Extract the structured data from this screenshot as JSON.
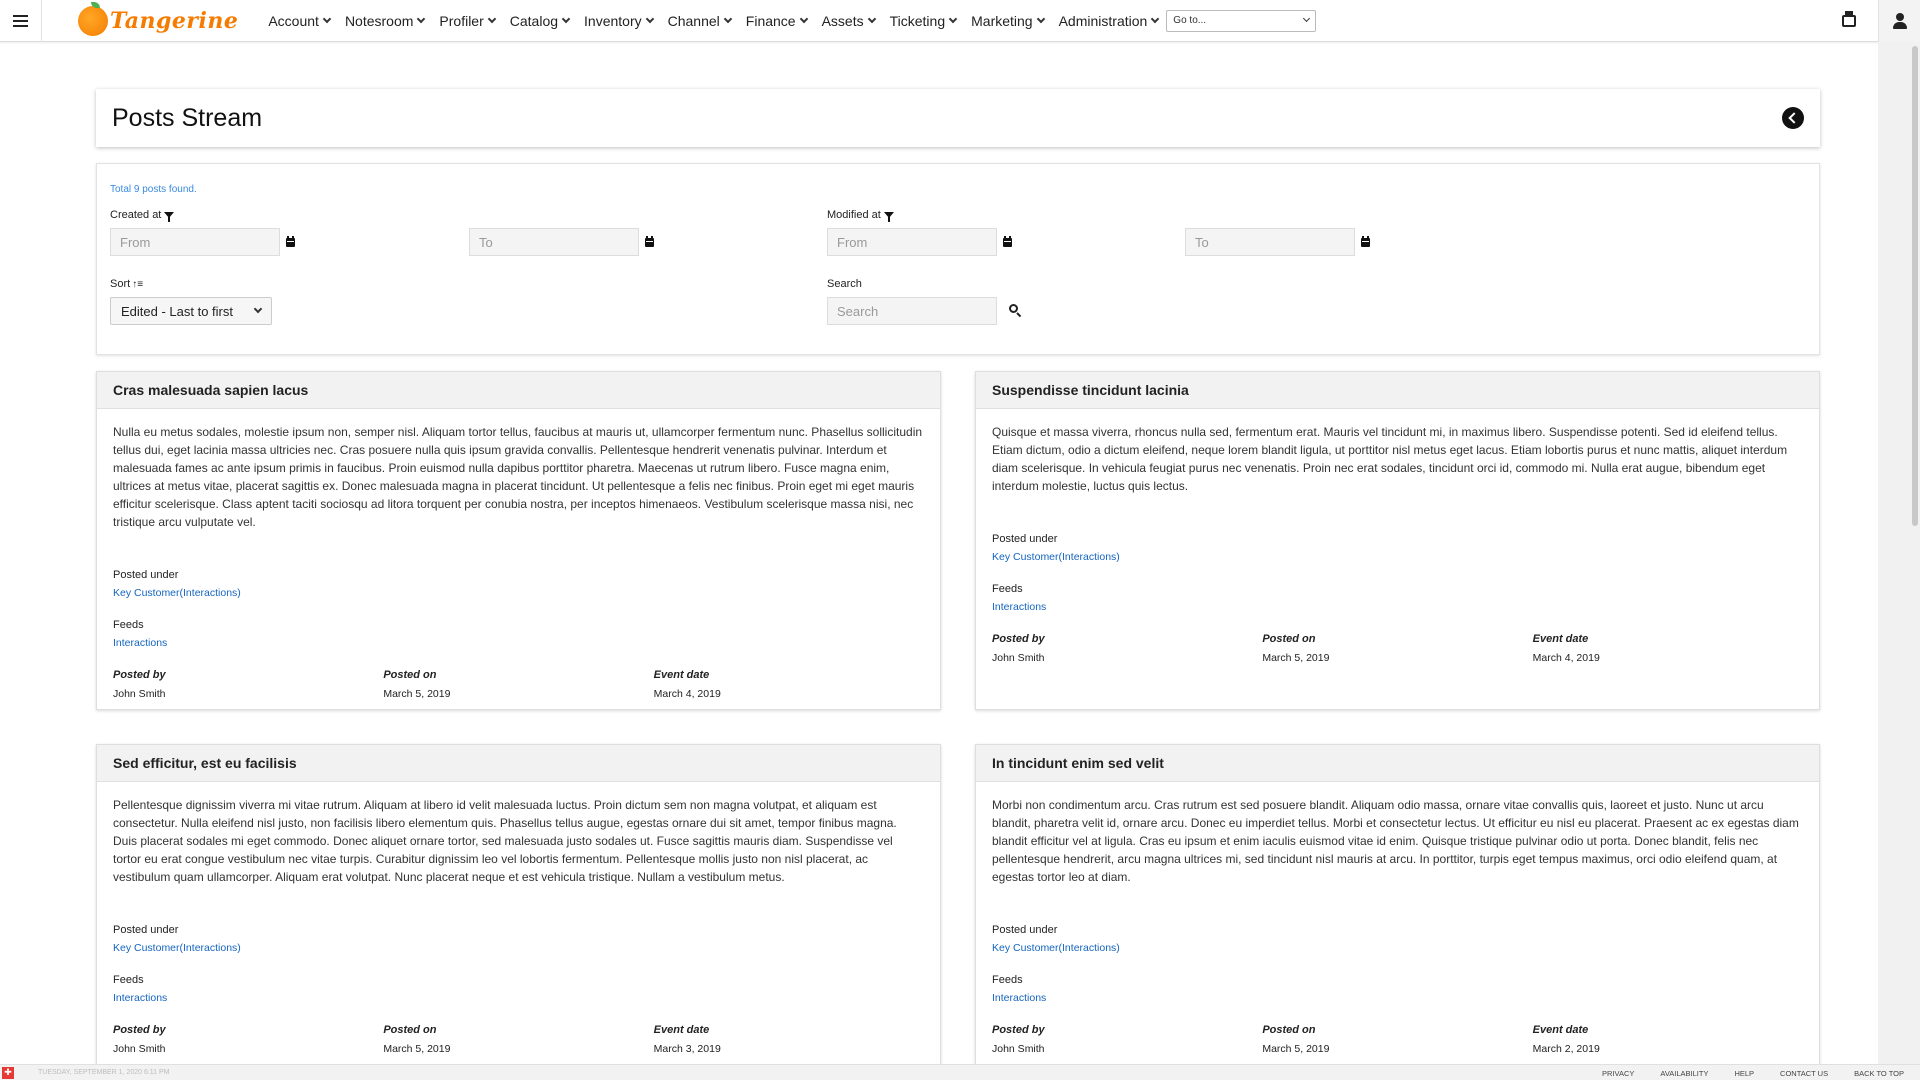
{
  "nav": {
    "brand": "Tangerine",
    "items": [
      "Account",
      "Notesroom",
      "Profiler",
      "Catalog",
      "Inventory",
      "Channel",
      "Finance",
      "Assets",
      "Ticketing",
      "Marketing",
      "Administration"
    ],
    "goto_label": "Go to..."
  },
  "header": {
    "title": "Posts Stream"
  },
  "filters": {
    "total": "Total 9 posts found.",
    "created_label": "Created at",
    "modified_label": "Modified at",
    "from_placeholder": "From",
    "to_placeholder": "To",
    "sort_label": "Sort",
    "sort_value": "Edited - Last to first",
    "search_label": "Search",
    "search_placeholder": "Search"
  },
  "labels": {
    "posted_under": "Posted under",
    "feeds": "Feeds",
    "posted_by": "Posted by",
    "posted_on": "Posted on",
    "event_date": "Event date"
  },
  "posts": [
    {
      "title": "Cras malesuada sapien lacus",
      "body": "Nulla eu metus sodales, molestie ipsum non, semper nisl. Aliquam tortor tellus, faucibus at mauris ut, ullamcorper fermentum nunc. Phasellus sollicitudin tellus dui, eget lacinia massa ultricies nec. Cras posuere nulla quis ipsum gravida convallis. Pellentesque hendrerit venenatis pulvinar. Interdum et malesuada fames ac ante ipsum primis in faucibus. Proin euismod nulla dapibus porttitor pharetra. Maecenas ut rutrum libero. Fusce magna enim, ultrices at metus vitae, placerat sagittis ex. Donec malesuada magna in placerat tincidunt. Ut pellentesque a felis nec finibus. Proin eget mi eget mauris efficitur scelerisque. Class aptent taciti sociosqu ad litora torquent per conubia nostra, per inceptos himenaeos. Vestibulum scelerisque massa nisi, nec tristique arcu vulputate vel.",
      "posted_under": "Key Customer(Interactions)",
      "feeds": "Interactions",
      "posted_by": "John Smith",
      "posted_on": "March 5, 2019",
      "event_date": "March 4, 2019"
    },
    {
      "title": "Suspendisse tincidunt lacinia",
      "body": "Quisque et massa viverra, rhoncus nulla sed, fermentum erat. Mauris vel tincidunt mi, in maximus libero. Suspendisse potenti. Sed id eleifend tellus. Etiam dictum, odio a dictum eleifend, neque lorem blandit ligula, ut porttitor nisl metus eget lacus. Etiam lobortis purus et nunc mattis, aliquet interdum diam scelerisque. In vehicula feugiat purus nec venenatis. Proin nec erat sodales, tincidunt orci id, commodo mi. Nulla erat augue, bibendum eget interdum molestie, luctus quis lectus.",
      "posted_under": "Key Customer(Interactions)",
      "feeds": "Interactions",
      "posted_by": "John Smith",
      "posted_on": "March 5, 2019",
      "event_date": "March 4, 2019"
    },
    {
      "title": "Sed efficitur, est eu facilisis",
      "body": "Pellentesque dignissim viverra mi vitae rutrum. Aliquam at libero id velit malesuada luctus. Proin dictum sem non magna volutpat, et aliquam est consectetur. Nulla eleifend nisl justo, non facilisis libero elementum quis. Phasellus tellus augue, egestas ornare dui sit amet, tempor finibus magna. Duis placerat sodales mi eget commodo. Donec aliquet ornare tortor, sed malesuada justo sodales ut. Fusce sagittis mauris diam. Suspendisse vel tortor eu erat congue vestibulum nec vitae turpis. Curabitur dignissim leo vel lobortis fermentum. Pellentesque mollis justo non nisl placerat, ac vestibulum quam ullamcorper. Aliquam erat volutpat. Nunc placerat neque et est vehicula tristique. Nullam a vestibulum metus.",
      "posted_under": "Key Customer(Interactions)",
      "feeds": "Interactions",
      "posted_by": "John Smith",
      "posted_on": "March 5, 2019",
      "event_date": "March 3, 2019"
    },
    {
      "title": "In tincidunt enim sed velit",
      "body": "Morbi non condimentum arcu. Cras rutrum est sed posuere blandit. Aliquam odio massa, ornare vitae convallis quis, laoreet et justo. Nunc ut arcu blandit, pharetra velit id, ornare arcu. Donec eu imperdiet tellus. Morbi et consectetur lectus. Ut efficitur eu nisl eu placerat. Praesent ac ex egestas diam blandit efficitur vel at ligula. Cras eu ipsum et enim iaculis euismod vitae id enim. Quisque tristique pulvinar odio ut porta. Donec blandit, felis nec pellentesque hendrerit, arcu magna ultrices mi, sed tincidunt nisl mauris at arcu. In porttitor, turpis eget tempus maximus, orci odio eleifend quam, at egestas tortor leo at diam.",
      "posted_under": "Key Customer(Interactions)",
      "feeds": "Interactions",
      "posted_by": "John Smith",
      "posted_on": "March 5, 2019",
      "event_date": "March 2, 2019"
    }
  ],
  "footer": {
    "date": "Tuesday, September 1, 2020 6:11 PM",
    "links": [
      "Privacy",
      "Availability",
      "Help",
      "Contact Us",
      "Back to top"
    ]
  },
  "colors": {
    "brand": "#f57c00",
    "link": "#1565c0",
    "total_text": "#3a8be0"
  },
  "icons": [
    "hamburger-icon",
    "print-icon",
    "user-icon",
    "back-icon",
    "calendar-icon",
    "funnel-icon",
    "sort-icon",
    "search-icon",
    "chevron-down-icon"
  ]
}
